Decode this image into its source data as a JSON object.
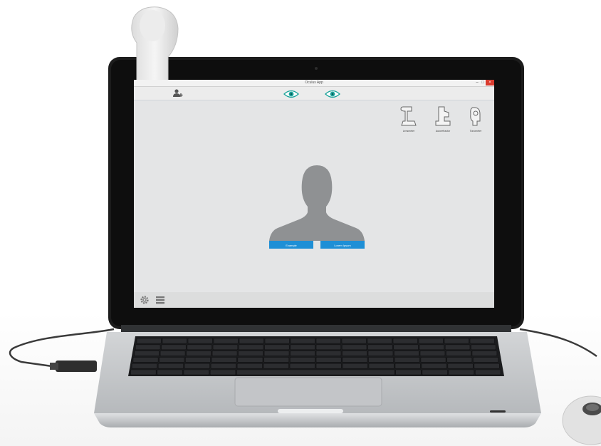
{
  "window": {
    "title": "Oculus App",
    "minimize_glyph": "–",
    "maximize_glyph": "□",
    "close_glyph": "×"
  },
  "toolbar": {
    "add_user_icon": "add-user-icon",
    "eye_right_icon": "eye-icon",
    "eye_left_icon": "eye-icon",
    "active_color": "#1aa39a"
  },
  "devices": [
    {
      "label": "Lensmeter",
      "icon": "lensmeter-icon"
    },
    {
      "label": "Autorefractor",
      "icon": "autorefractor-icon"
    },
    {
      "label": "Tonometer",
      "icon": "tonometer-icon"
    }
  ],
  "patient": {
    "avatar_icon": "user-silhouette-icon",
    "primary_button": "Example",
    "secondary_button": "Lorem Ipsum"
  },
  "footer": {
    "settings_icon": "gear-icon",
    "menu_icon": "menu-icon"
  },
  "colors": {
    "accent": "#1e8fd6",
    "screen_bg": "#e4e5e6",
    "laptop_body": "#c9cbcd"
  }
}
